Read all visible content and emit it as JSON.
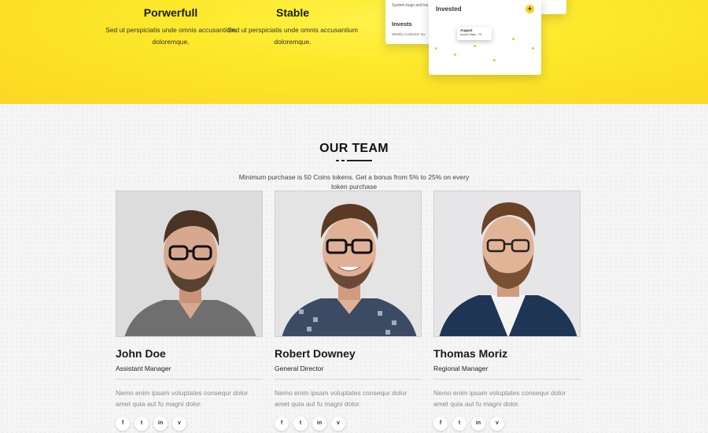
{
  "features": [
    {
      "title": "Porwerfull",
      "text": "Sed ut perspiciatis unde omnis accusantium doloremque."
    },
    {
      "title": "Stable",
      "text": "Sed ut perspiciatis unde omnis accusantium doloremque."
    }
  ],
  "dashboard": {
    "back_line1": "System bugs and iss",
    "back_title": "Invests",
    "back_line2": "Weekly Customer Inv",
    "front_title": "Invested",
    "plus": "+",
    "tooltip_month": "August",
    "tooltip_text": "Invest Stats : 79"
  },
  "team": {
    "title": "OUR TEAM",
    "subtitle": "Minimum purchase is 50 Coins tokens. Get a bonus from 5% to 25% on every token purchase",
    "members": [
      {
        "name": "John Doe",
        "role": "Assistant Manager",
        "desc": "Nemo enim ipsam voluptates consequr dolor amet quia aut fu magni dolor."
      },
      {
        "name": "Robert Downey",
        "role": "General Director",
        "desc": "Nemo enim ipsam voluptates consequr dolor amet quia aut fu magni dolor."
      },
      {
        "name": "Thomas Moriz",
        "role": "Regional Manager",
        "desc": "Nemo enim ipsam voluptates consequr dolor amet quia aut fu magni dolor."
      }
    ],
    "social": [
      "f",
      "t",
      "in",
      "v"
    ],
    "social_icons": [
      "facebook-icon",
      "twitter-icon",
      "linkedin-icon",
      "vimeo-icon"
    ]
  },
  "colors": {
    "accent": "#fbd723",
    "text": "#1a1a1a",
    "muted": "#8a8a8a"
  }
}
